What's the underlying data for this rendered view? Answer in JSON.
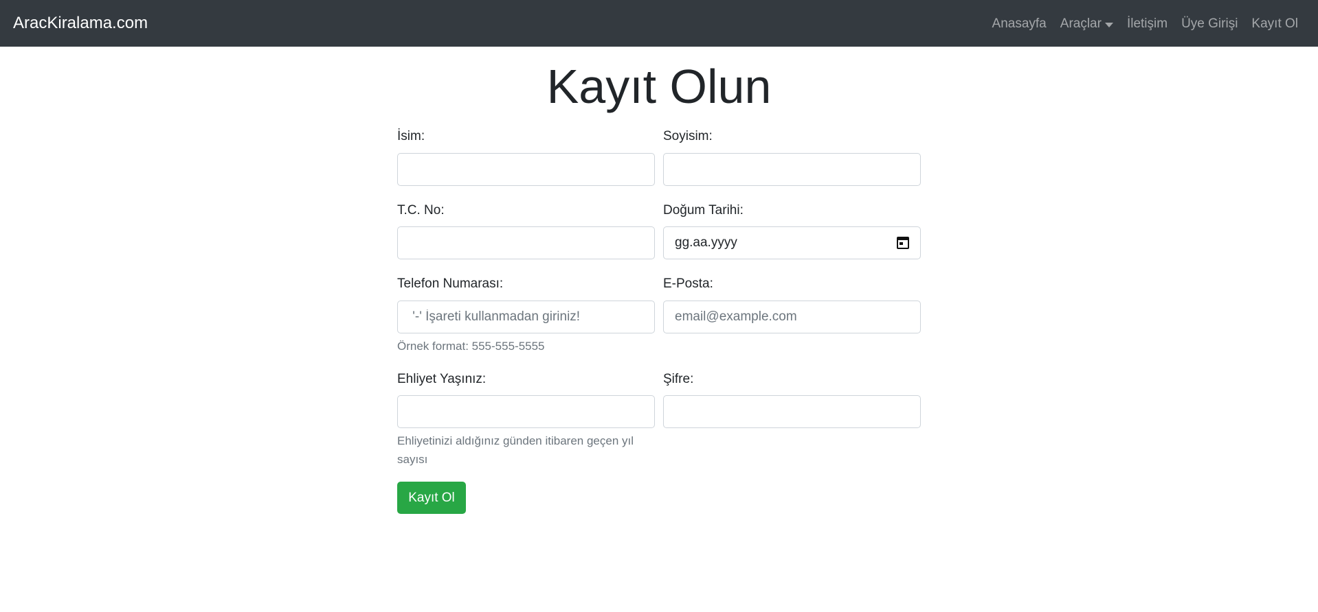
{
  "navbar": {
    "brand": "AracKiralama.com",
    "links": [
      "Anasayfa",
      "Araçlar",
      "İletişim",
      "Üye Girişi",
      "Kayıt Ol"
    ]
  },
  "page": {
    "title": "Kayıt Olun"
  },
  "form": {
    "first_name": {
      "label": "İsim:",
      "value": ""
    },
    "last_name": {
      "label": "Soyisim:",
      "value": ""
    },
    "tc_no": {
      "label": "T.C. No:",
      "value": ""
    },
    "birth_date": {
      "label": "Doğum Tarihi:",
      "value": "gg.aa.yyyy"
    },
    "phone": {
      "label": "Telefon Numarası:",
      "placeholder": " '-' İşareti kullanmadan giriniz!",
      "help": "Örnek format: 555-555-5555"
    },
    "email": {
      "label": "E-Posta:",
      "placeholder": "email@example.com"
    },
    "license_years": {
      "label": "Ehliyet Yaşınız:",
      "help": "Ehliyetinizi aldığınız günden itibaren geçen yıl sayısı"
    },
    "password": {
      "label": "Şifre:",
      "value": ""
    },
    "submit_label": "Kayıt Ol"
  }
}
